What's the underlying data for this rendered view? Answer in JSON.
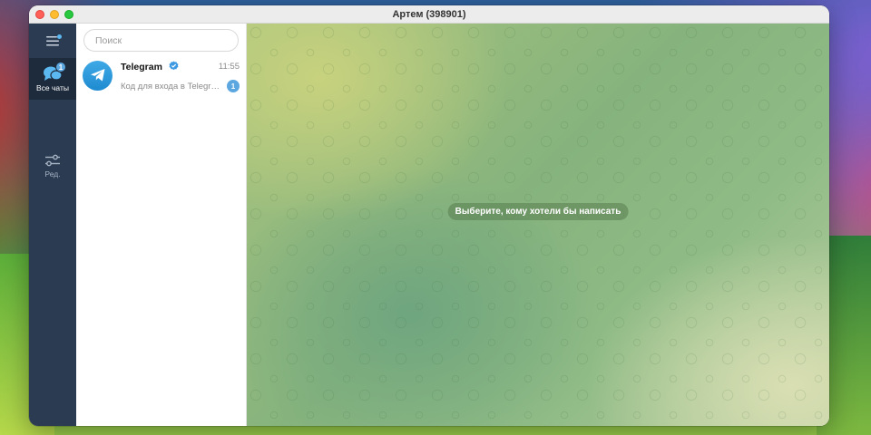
{
  "window": {
    "title": "Артем (398901)"
  },
  "rail": {
    "all_chats": {
      "label": "Все чаты",
      "badge": "1"
    },
    "edit": {
      "label": "Ред."
    }
  },
  "search": {
    "placeholder": "Поиск",
    "value": ""
  },
  "chats": [
    {
      "name": "Telegram",
      "verified": true,
      "time": "11:55",
      "preview": "Код для входа в Telegram",
      "unread": "1"
    }
  ],
  "main": {
    "empty_hint": "Выберите, кому хотели бы написать"
  },
  "colors": {
    "rail_bg": "#2a3b52",
    "accent": "#5ca7e0"
  }
}
